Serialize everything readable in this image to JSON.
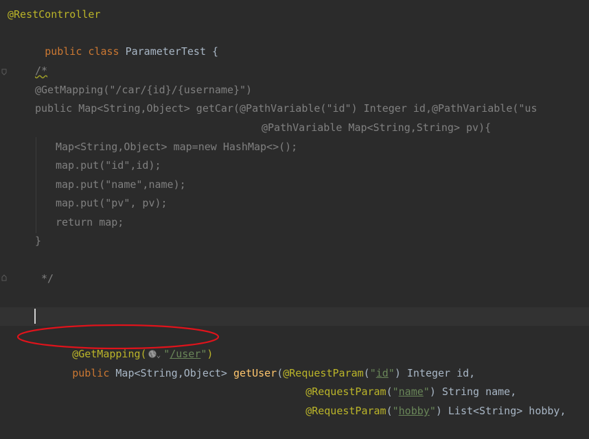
{
  "code": {
    "l1_annotation": "@RestController",
    "l2_kw": "public class ",
    "l2_name": "ParameterTest {",
    "l4_comment_open": "/*",
    "l5": "@GetMapping(\"/car/{id}/{username}\")",
    "l6": "public Map<String,Object> getCar(@PathVariable(\"id\") Integer id,@PathVariable(\"us",
    "l7": "@PathVariable Map<String,String> pv){",
    "l8": "Map<String,Object> map=new HashMap<>();",
    "l9": "map.put(\"id\",id);",
    "l10": "map.put(\"name\",name);",
    "l11": "map.put(\"pv\", pv);",
    "l12": "return map;",
    "l13": "}",
    "l15_comment_close": "*/",
    "l18_ann": "@GetMapping(",
    "l18_q1": "\"",
    "l18_url": "/user",
    "l18_q2": "\"",
    "l18_paren": ")",
    "l19_kw": "public",
    "l19_type": " Map<String,Object> ",
    "l19_method": "getUser",
    "l19_paren": "(",
    "l19_ann": "@RequestParam",
    "l19_p1": "(",
    "l19_q1": "\"",
    "l19_ref": "id",
    "l19_q2": "\"",
    "l19_rest": ") Integer id,",
    "l20_ann": "@RequestParam",
    "l20_p1": "(",
    "l20_q1": "\"",
    "l20_ref": "name",
    "l20_q2": "\"",
    "l20_rest": ") String name,",
    "l21_ann": "@RequestParam",
    "l21_p1": "(",
    "l21_q1": "\"",
    "l21_ref": "hobby",
    "l21_q2": "\"",
    "l21_rest": ") List<String> hobby,",
    "chevron": "⌄"
  },
  "colors": {
    "background": "#2b2b2b",
    "keyword": "#cc7832",
    "annotation": "#bbb529",
    "comment": "#808080",
    "string": "#6a8759",
    "default": "#a9b7c6",
    "highlight_ellipse": "#e0131b"
  }
}
